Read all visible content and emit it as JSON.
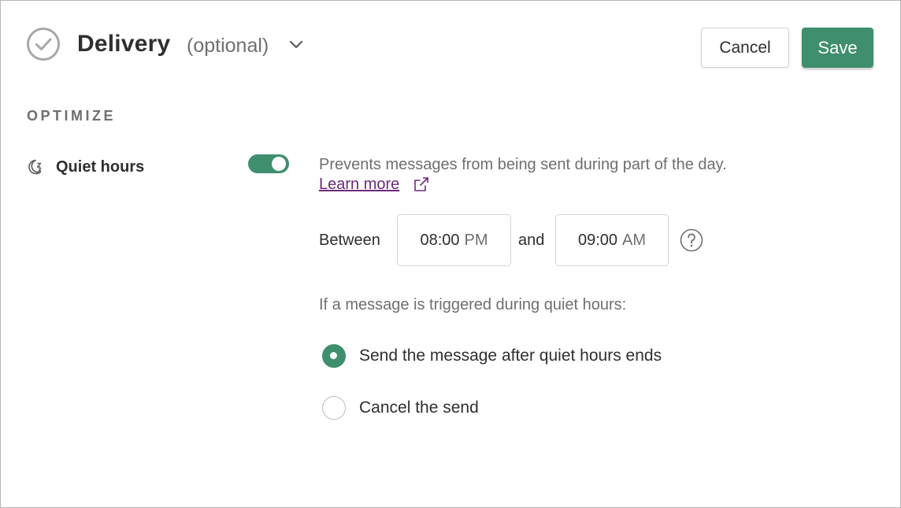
{
  "header": {
    "title": "Delivery",
    "optional_label": "(optional)",
    "cancel_label": "Cancel",
    "save_label": "Save",
    "icons": [
      "check-circle-icon",
      "chevron-down-icon"
    ]
  },
  "section": {
    "label": "OPTIMIZE"
  },
  "quiet_hours": {
    "label": "Quiet hours",
    "icon": "moon-zzz-icon",
    "enabled": true,
    "description": "Prevents messages from being sent during part of the day.",
    "learn_more_label": "Learn more",
    "between_label": "Between",
    "start_time": "08:00",
    "start_ampm": "PM",
    "and_label": "and",
    "end_time": "09:00",
    "end_ampm": "AM",
    "trigger_prompt": "If a message is triggered during quiet hours:",
    "options": [
      {
        "label": "Send the message after quiet hours ends",
        "selected": true
      },
      {
        "label": "Cancel the send",
        "selected": false
      }
    ]
  },
  "colors": {
    "accent": "#3f8f6f",
    "link": "#6b2a7a",
    "muted_text": "#6f6f6f",
    "text": "#2f2f2f"
  }
}
